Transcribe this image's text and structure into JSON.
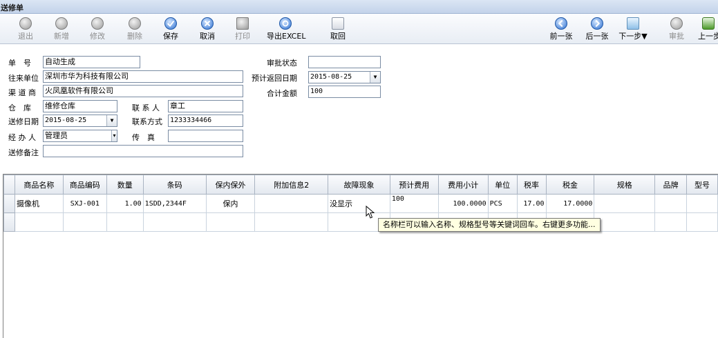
{
  "window": {
    "title": "送修单"
  },
  "toolbar": {
    "exit": "退出",
    "add": "新增",
    "edit": "修改",
    "delete": "删除",
    "save": "保存",
    "cancel": "取消",
    "print": "打印",
    "export": "导出EXCEL",
    "retrieve": "取回",
    "prev": "前一张",
    "next": "后一张",
    "next_step": "下一步▼",
    "approve": "审批",
    "prev_step": "上一步"
  },
  "form": {
    "order_no_label": "单　号",
    "order_no": "自动生成",
    "partner_label": "往来单位",
    "partner": "深圳市华为科技有限公司",
    "channel_label": "渠 道 商",
    "channel": "火凤凰软件有限公司",
    "warehouse_label": "仓　库",
    "warehouse": "维修仓库",
    "contact_label": "联 系 人",
    "contact": "章工",
    "send_date_label": "送修日期",
    "send_date": "2015-08-25",
    "contact_phone_label": "联系方式",
    "contact_phone": "1233334466",
    "handler_label": "经 办 人",
    "handler": "管理员",
    "fax_label": "传　真",
    "fax": "",
    "remark_label": "送修备注",
    "remark": "",
    "approval_status_label": "审批状态",
    "approval_status": "",
    "return_date_label": "预计返回日期",
    "return_date": "2015-08-25",
    "total_label": "合计金额",
    "total": "100"
  },
  "grid": {
    "columns": [
      "商品名称",
      "商品编码",
      "数量",
      "条码",
      "保内保外",
      "附加信息2",
      "故障现象",
      "预计费用",
      "费用小计",
      "单位",
      "税率",
      "税金",
      "规格",
      "品牌",
      "型号"
    ],
    "rows": [
      [
        "摄像机",
        "SXJ-001",
        "1.00",
        "1SDD,2344F",
        "保内",
        "",
        "没显示",
        "100",
        "100.0000",
        "PCS",
        "17.00",
        "17.0000",
        "",
        "",
        ""
      ]
    ]
  },
  "tooltip": {
    "text": "名称栏可以输入名称、规格型号等关键词回车。右键更多功能..."
  }
}
